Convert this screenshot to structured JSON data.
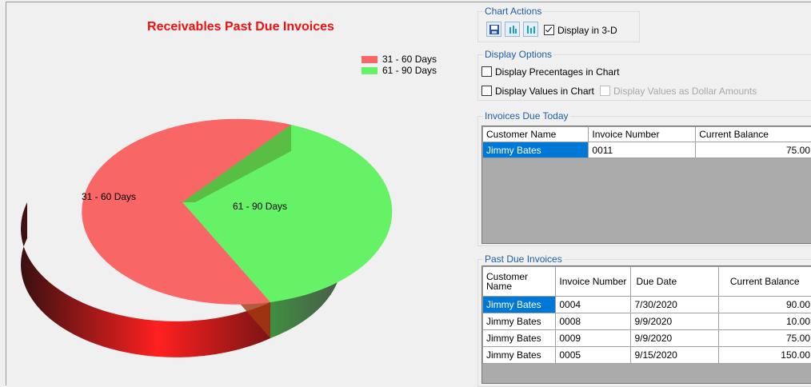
{
  "chart": {
    "title": "Receivables Past Due Invoices",
    "legend": [
      {
        "label": "31 - 60 Days",
        "color": "#f86666"
      },
      {
        "label": "61 - 90 Days",
        "color": "#66f266"
      }
    ]
  },
  "chart_data": {
    "type": "pie",
    "title": "Receivables Past Due Invoices",
    "three_d": true,
    "legend_position": "top-right",
    "series": [
      {
        "name": "31 - 60 Days",
        "value": 69.0,
        "color": "#f86666"
      },
      {
        "name": "61 - 90 Days",
        "value": 31.0,
        "color": "#66f266"
      }
    ]
  },
  "chart_actions": {
    "title": "Chart Actions",
    "display_3d_label": "Display in 3-D",
    "display_3d_checked": true,
    "buttons": [
      "save-icon",
      "bar-chart-icon",
      "bar-chart-alt-icon"
    ]
  },
  "display_options": {
    "title": "Display Options",
    "percentages_label": "Display Precentages in Chart",
    "values_label": "Display Values in Chart",
    "dollar_label": "Display Values as Dollar Amounts"
  },
  "invoices_due_today": {
    "title": "Invoices Due Today",
    "columns": [
      "Customer Name",
      "Invoice Number",
      "Current Balance"
    ],
    "rows": [
      [
        "Jimmy Bates",
        "0011",
        "75.00"
      ]
    ]
  },
  "past_due_invoices": {
    "title": "Past Due Invoices",
    "columns": [
      "Customer Name",
      "Invoice Number",
      "Due Date",
      "Current Balance"
    ],
    "rows": [
      [
        "Jimmy Bates",
        "0004",
        "7/30/2020",
        "90.00"
      ],
      [
        "Jimmy Bates",
        "0008",
        "9/9/2020",
        "10.00"
      ],
      [
        "Jimmy Bates",
        "0009",
        "9/9/2020",
        "75.00"
      ],
      [
        "Jimmy Bates",
        "0005",
        "9/15/2020",
        "150.00"
      ]
    ]
  }
}
